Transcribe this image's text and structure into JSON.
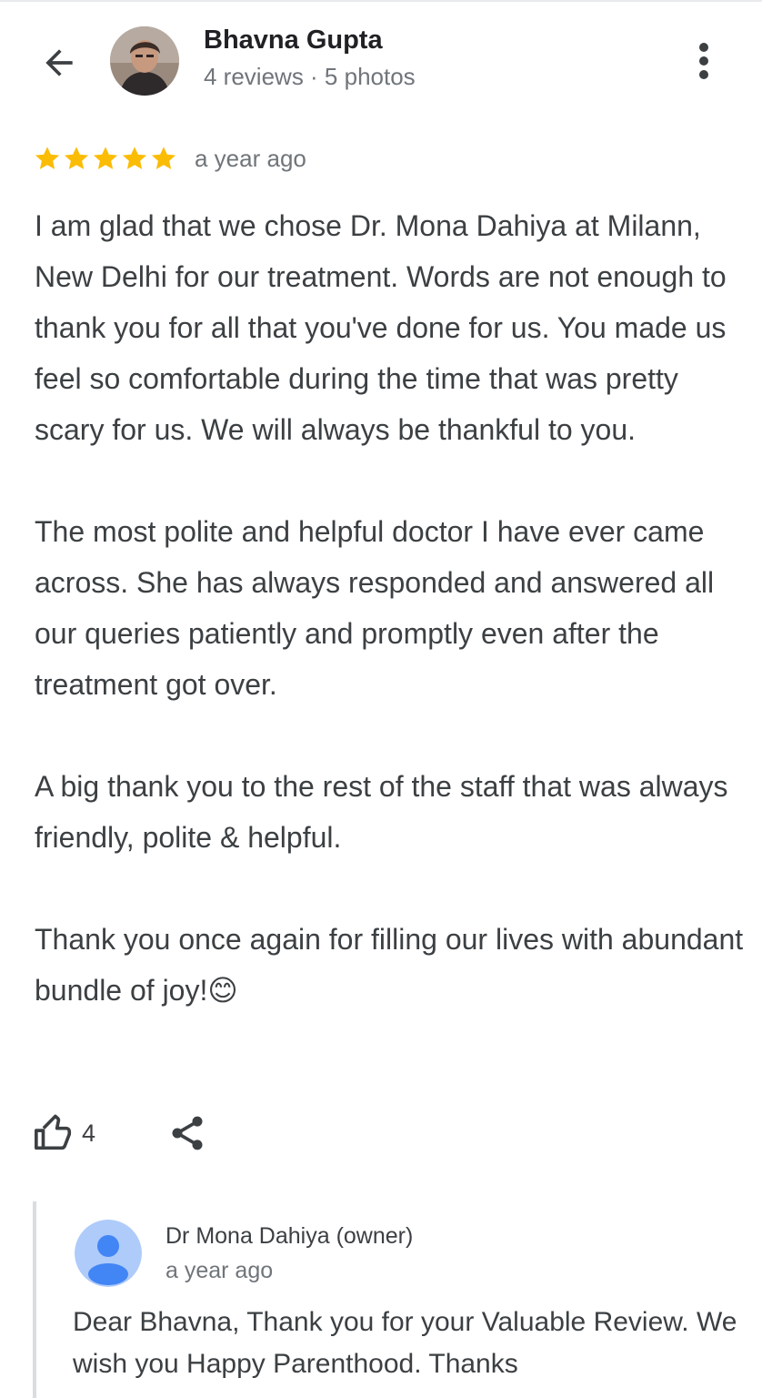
{
  "header": {
    "back_icon": "arrow-left-icon",
    "author_name": "Bhavna Gupta",
    "author_meta": "4 reviews · 5 photos",
    "more_icon": "more-vert-icon"
  },
  "review": {
    "rating": 5,
    "rating_max": 5,
    "star_color": "#fbbc04",
    "time": "a year ago",
    "text": "I am glad that we chose Dr. Mona Dahiya at Milann, New Delhi for our treatment. Words are not enough to thank you for all that you've done for us. You made us feel so comfortable during the time that was pretty scary for us. We will always be thankful to you.\n\nThe most polite and helpful doctor I have ever came across. She has always responded and answered all our queries patiently and promptly even after the treatment got over.\n\nA big thank you to the rest of the staff that was always friendly, polite & helpful.\n\nThank you once again for filling our lives with abundant bundle of joy!😊"
  },
  "actions": {
    "like_icon": "thumbs-up-icon",
    "like_count": "4",
    "share_icon": "share-icon"
  },
  "owner_reply": {
    "name": "Dr Mona Dahiya (owner)",
    "time": "a year ago",
    "text": "Dear Bhavna, Thank you for your Valuable Review. We wish you Happy Parenthood. Thanks",
    "avatar_color": "#aecbfa",
    "avatar_figure_color": "#4285f4"
  }
}
